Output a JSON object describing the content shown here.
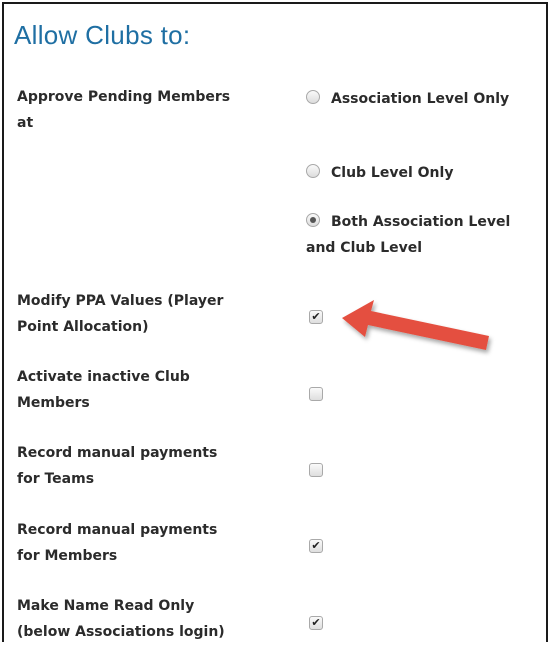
{
  "heading": "Allow Clubs to:",
  "approve": {
    "label": "Approve Pending Members at",
    "options": [
      {
        "label": "Association Level Only",
        "selected": false
      },
      {
        "label": "Club Level Only",
        "selected": false
      },
      {
        "label": "Both Association Level and Club Level",
        "selected": true
      }
    ]
  },
  "settings": [
    {
      "label": "Modify PPA Values (Player Point Allocation)",
      "checked": true
    },
    {
      "label": "Activate inactive Club Members",
      "checked": false
    },
    {
      "label": "Record manual payments for Teams",
      "checked": false
    },
    {
      "label": "Record manual payments for Members",
      "checked": true
    },
    {
      "label": "Make Name Read Only (below Associations login)",
      "checked": true
    }
  ],
  "annotation": {
    "color": "#e4503f"
  }
}
